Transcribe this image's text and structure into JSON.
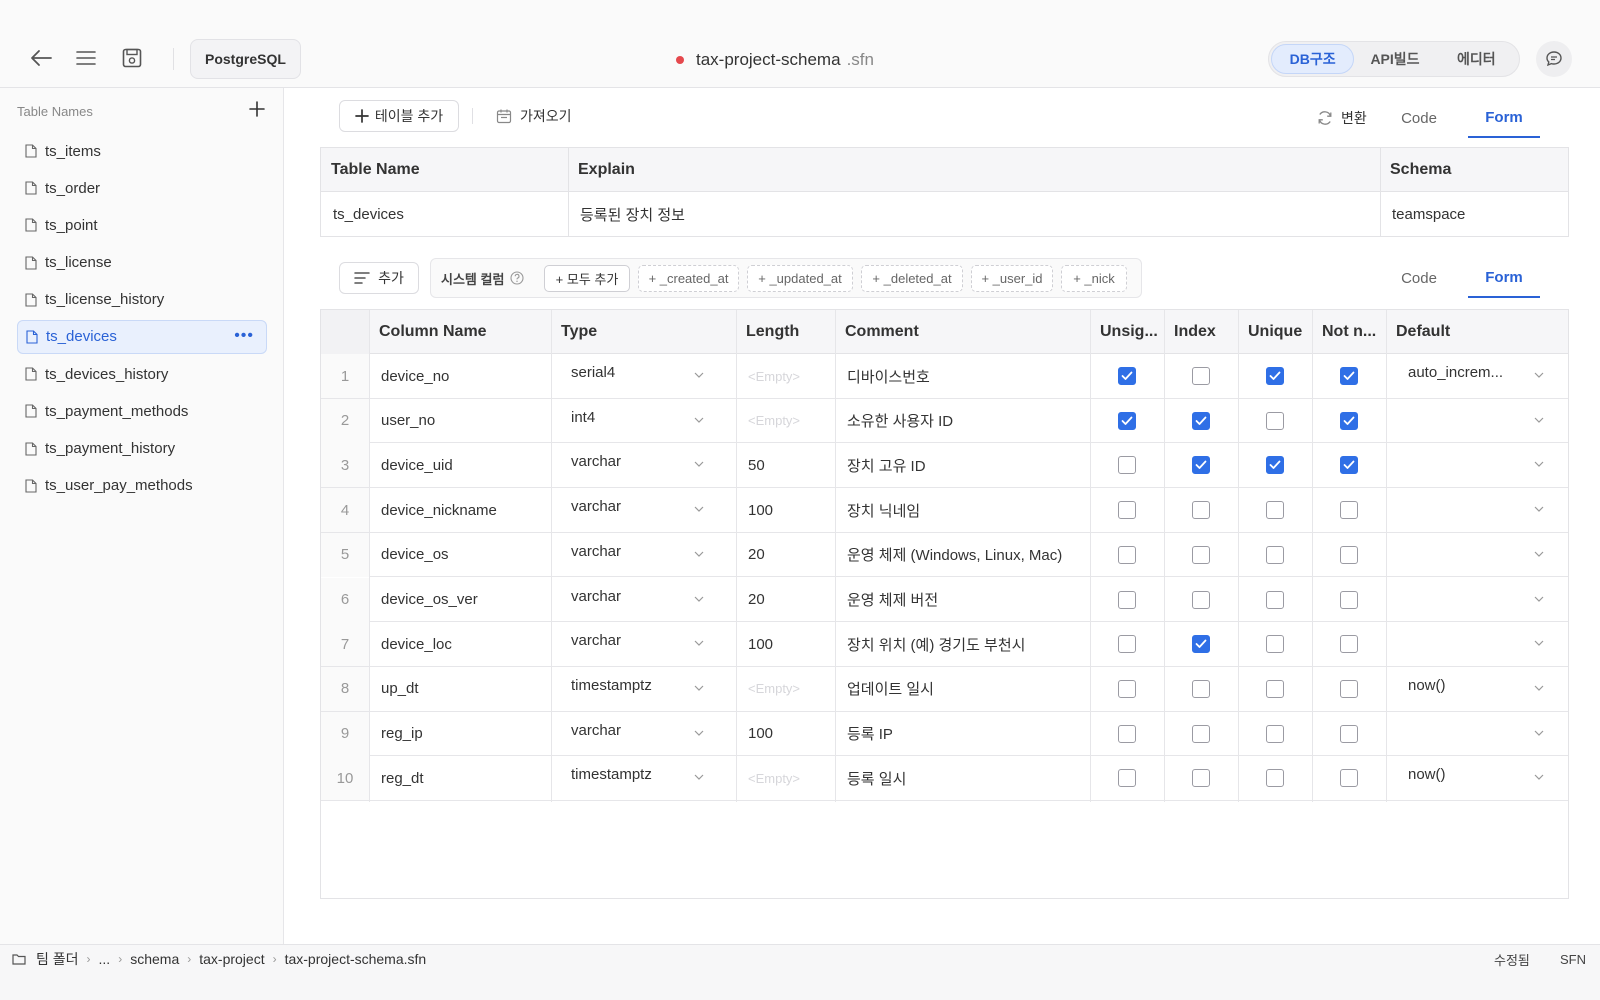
{
  "topbar": {
    "db_engine": "PostgreSQL",
    "file_name": "tax-project-schema",
    "file_ext": ".sfn",
    "modes": [
      "DB구조",
      "API빌드",
      "에디터"
    ],
    "active_mode": "DB구조",
    "unsaved_color": "#e5484d"
  },
  "sidebar": {
    "header": "Table Names",
    "items": [
      {
        "label": "ts_items"
      },
      {
        "label": "ts_order"
      },
      {
        "label": "ts_point"
      },
      {
        "label": "ts_license"
      },
      {
        "label": "ts_license_history"
      },
      {
        "label": "ts_devices",
        "active": true
      },
      {
        "label": "ts_devices_history"
      },
      {
        "label": "ts_payment_methods"
      },
      {
        "label": "ts_payment_history"
      },
      {
        "label": "ts_user_pay_methods"
      }
    ]
  },
  "toolbar": {
    "add_table_label": "테이블 추가",
    "import_label": "가져오기",
    "convert_label": "변환",
    "tab_code": "Code",
    "tab_form": "Form"
  },
  "table_info": {
    "headers": {
      "name": "Table Name",
      "explain": "Explain",
      "schema": "Schema"
    },
    "name": "ts_devices",
    "explain": "등록된 장치 정보",
    "schema": "teamspace"
  },
  "columns_toolbar": {
    "add_label": "추가",
    "system_columns_label": "시스템 컬럼",
    "add_all_label": "+ 모두 추가",
    "chips": [
      "+ _created_at",
      "+ _updated_at",
      "+ _deleted_at",
      "+ _user_id",
      "+ _nick"
    ],
    "tab_code": "Code",
    "tab_form": "Form"
  },
  "grid": {
    "headers": {
      "column_name": "Column Name",
      "type": "Type",
      "length": "Length",
      "comment": "Comment",
      "unsigned": "Unsig...",
      "index": "Index",
      "unique": "Unique",
      "not_null": "Not n...",
      "default": "Default"
    },
    "empty_placeholder": "<Empty>",
    "rows": [
      {
        "n": "1",
        "name": "device_no",
        "type": "serial4",
        "length": "",
        "comment": "디바이스번호",
        "unsigned": true,
        "index": false,
        "unique": true,
        "not_null": true,
        "default": "auto_increm..."
      },
      {
        "n": "2",
        "name": "user_no",
        "type": "int4",
        "length": "",
        "comment": "소유한 사용자 ID",
        "unsigned": true,
        "index": true,
        "unique": false,
        "not_null": true,
        "default": ""
      },
      {
        "n": "3",
        "name": "device_uid",
        "type": "varchar",
        "length": "50",
        "comment": "장치 고유 ID",
        "unsigned": false,
        "index": true,
        "unique": true,
        "not_null": true,
        "default": ""
      },
      {
        "n": "4",
        "name": "device_nickname",
        "type": "varchar",
        "length": "100",
        "comment": "장치 닉네임",
        "unsigned": false,
        "index": false,
        "unique": false,
        "not_null": false,
        "default": ""
      },
      {
        "n": "5",
        "name": "device_os",
        "type": "varchar",
        "length": "20",
        "comment": "운영 체제 (Windows, Linux, Mac)",
        "unsigned": false,
        "index": false,
        "unique": false,
        "not_null": false,
        "default": ""
      },
      {
        "n": "6",
        "name": "device_os_ver",
        "type": "varchar",
        "length": "20",
        "comment": "운영 체제 버전",
        "unsigned": false,
        "index": false,
        "unique": false,
        "not_null": false,
        "default": ""
      },
      {
        "n": "7",
        "name": "device_loc",
        "type": "varchar",
        "length": "100",
        "comment": "장치 위치 (예) 경기도 부천시",
        "unsigned": false,
        "index": true,
        "unique": false,
        "not_null": false,
        "default": ""
      },
      {
        "n": "8",
        "name": "up_dt",
        "type": "timestamptz",
        "length": "",
        "comment": "업데이트 일시",
        "unsigned": false,
        "index": false,
        "unique": false,
        "not_null": false,
        "default": "now()"
      },
      {
        "n": "9",
        "name": "reg_ip",
        "type": "varchar",
        "length": "100",
        "comment": "등록 IP",
        "unsigned": false,
        "index": false,
        "unique": false,
        "not_null": false,
        "default": ""
      },
      {
        "n": "10",
        "name": "reg_dt",
        "type": "timestamptz",
        "length": "",
        "comment": "등록 일시",
        "unsigned": false,
        "index": false,
        "unique": false,
        "not_null": false,
        "default": "now()"
      }
    ]
  },
  "footer": {
    "breadcrumb": [
      "팀 폴더",
      "...",
      "schema",
      "tax-project",
      "tax-project-schema.sfn"
    ],
    "status": "수정됨",
    "format": "SFN"
  },
  "colors": {
    "accent": "#2a62d6",
    "checkbox_on": "#2f6fe6"
  }
}
